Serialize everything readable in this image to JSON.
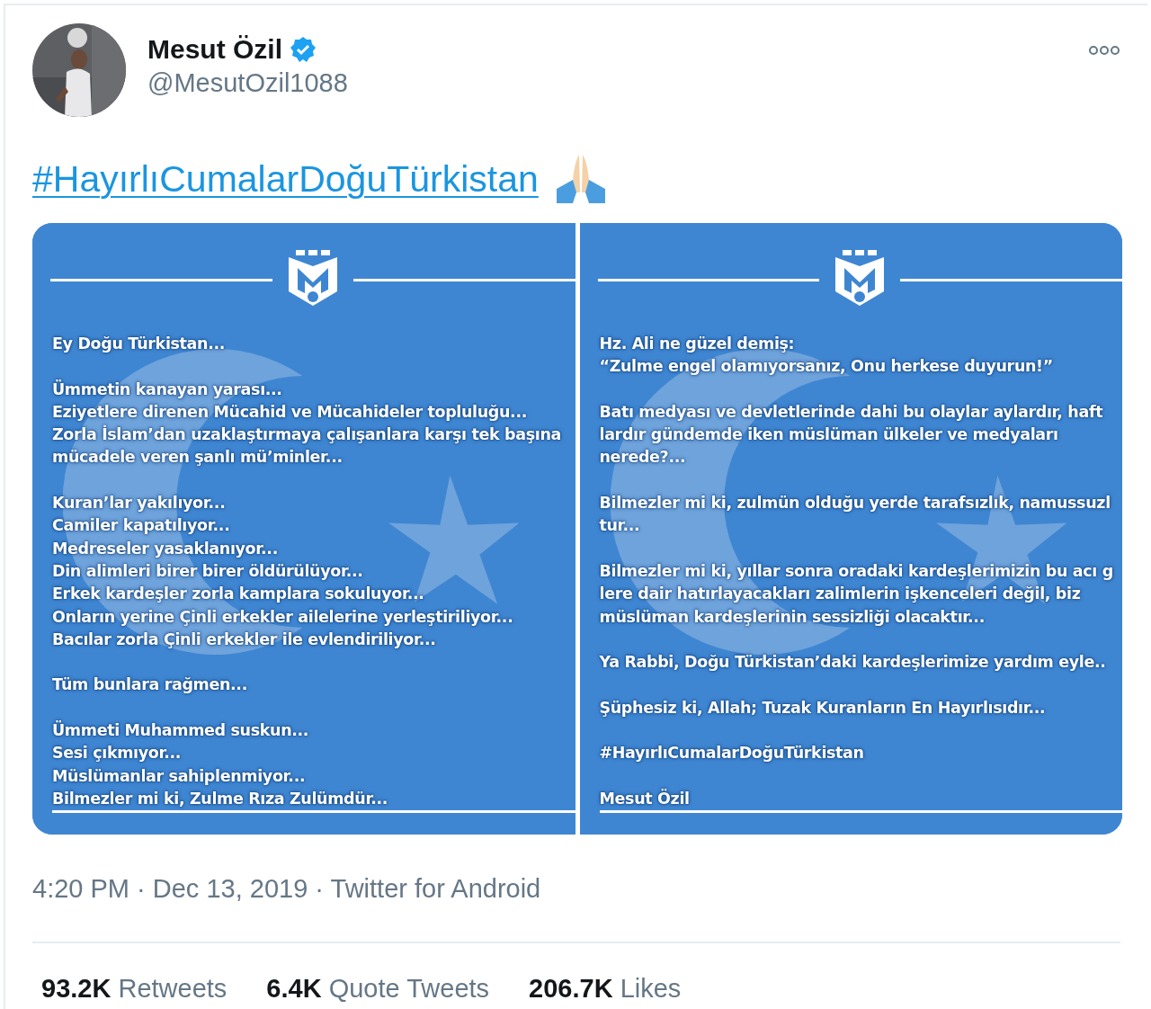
{
  "author": {
    "name": "Mesut Özil",
    "handle": "@MesutOzil1088",
    "verified": true
  },
  "text": {
    "hashtag": "#HayırlıCumalarDoğuTürkistan"
  },
  "media": [
    {
      "paragraphs": [
        [
          "Ey Doğu Türkistan..."
        ],
        [
          "Ümmetin kanayan yarası...",
          "Eziyetlere direnen Mücahid ve Mücahideler topluluğu...",
          "Zorla İslam’dan uzaklaştırmaya çalışanlara karşı tek başına",
          "mücadele veren şanlı mü’minler..."
        ],
        [
          "Kuran’lar yakılıyor...",
          "Camiler kapatılıyor...",
          "Medreseler yasaklanıyor...",
          "Din alimleri birer birer öldürülüyor...",
          "Erkek kardeşler zorla kamplara sokuluyor...",
          "Onların yerine Çinli erkekler ailelerine yerleştiriliyor...",
          "Bacılar zorla Çinli erkekler ile evlendiriliyor..."
        ],
        [
          "Tüm bunlara rağmen..."
        ],
        [
          "Ümmeti Muhammed suskun...",
          "Sesi çıkmıyor...",
          "Müslümanlar sahiplenmiyor...",
          "Bilmezler mi ki, Zulme Rıza Zulümdür..."
        ]
      ]
    },
    {
      "paragraphs": [
        [
          "Hz. Ali ne güzel demiş:",
          "“Zulme engel olamıyorsanız, Onu herkese duyurun!”"
        ],
        [
          "Batı medyası ve devletlerinde dahi bu olaylar aylardır, haft",
          "lardır gündemde iken müslüman ülkeler ve medyaları",
          "nerede?..."
        ],
        [
          "Bilmezler mi ki, zulmün olduğu yerde tarafsızlık, namussuzl",
          "tur..."
        ],
        [
          "Bilmezler mi ki, yıllar sonra oradaki kardeşlerimizin bu acı g",
          "lere dair hatırlayacakları zalimlerin işkenceleri değil, biz",
          "müslüman kardeşlerinin sessizliği olacaktır..."
        ],
        [
          "Ya Rabbi, Doğu Türkistan’daki kardeşlerimize yardım eyle.."
        ],
        [
          "Şüphesiz ki, Allah; Tuzak Kuranların En Hayırlısıdır..."
        ],
        [
          "#HayırlıCumalarDoğuTürkistan"
        ],
        [
          "Mesut Özil"
        ]
      ]
    }
  ],
  "meta": "4:20 PM · Dec 13, 2019 · Twitter for Android",
  "stats": [
    {
      "count": "93.2K",
      "label": "Retweets"
    },
    {
      "count": "6.4K",
      "label": "Quote Tweets"
    },
    {
      "count": "206.7K",
      "label": "Likes"
    }
  ]
}
